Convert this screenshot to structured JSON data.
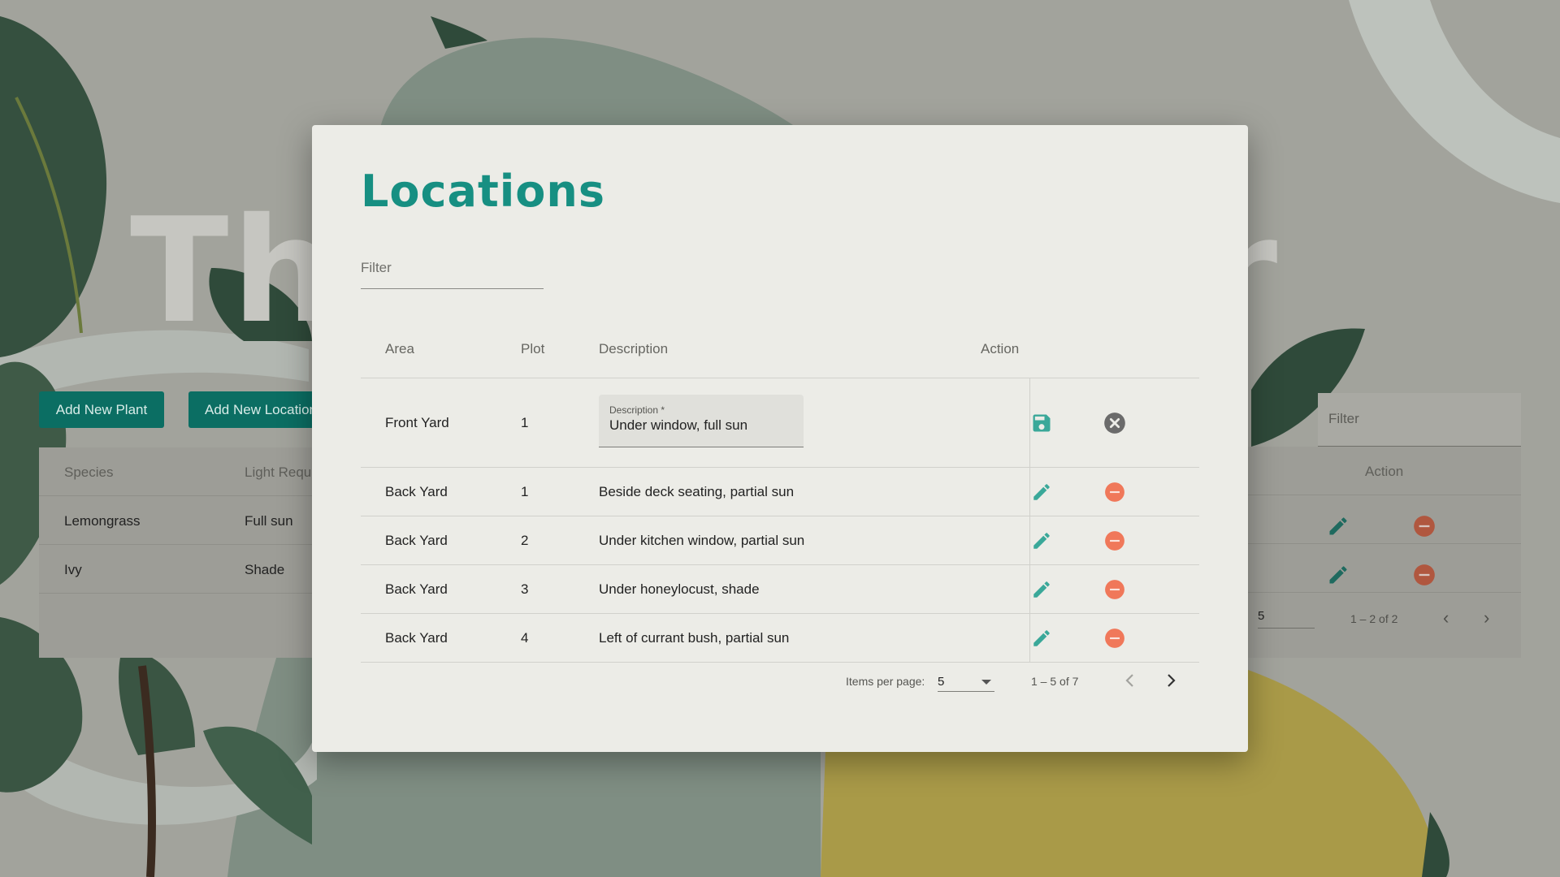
{
  "background": {
    "title": "The Gardener",
    "buttons": {
      "add_plant": "Add New Plant",
      "add_location": "Add New Location"
    },
    "plants_table": {
      "headers": [
        "Species",
        "Light Requirement"
      ],
      "rows": [
        [
          "Lemongrass",
          "Full sun"
        ],
        [
          "Ivy",
          "Shade"
        ]
      ],
      "filter_placeholder": "Filter",
      "action_header": "Action",
      "items_per_page": "5",
      "range": "1 – 2 of 2"
    }
  },
  "modal": {
    "title": "Locations",
    "filter_placeholder": "Filter",
    "headers": {
      "area": "Area",
      "plot": "Plot",
      "description": "Description",
      "action": "Action"
    },
    "editing_row": {
      "area": "Front Yard",
      "plot": "1",
      "description_label": "Description *",
      "description_value": "Under window, full sun"
    },
    "rows": [
      {
        "area": "Back Yard",
        "plot": "1",
        "description": "Beside deck seating, partial sun"
      },
      {
        "area": "Back Yard",
        "plot": "2",
        "description": "Under kitchen window, partial sun"
      },
      {
        "area": "Back Yard",
        "plot": "3",
        "description": "Under honeylocust, shade"
      },
      {
        "area": "Back Yard",
        "plot": "4",
        "description": "Left of currant bush, partial sun"
      }
    ],
    "paginator": {
      "items_per_page_label": "Items per page:",
      "items_per_page": "5",
      "range": "1 – 5 of 7"
    }
  },
  "icons": {
    "save": "save-icon",
    "cancel": "cancel-circle-icon",
    "edit": "pencil-icon",
    "delete": "minus-circle-icon",
    "prev": "chevron-left-icon",
    "next": "chevron-right-icon"
  },
  "colors": {
    "accent": "#178f82",
    "edit": "#3aa899",
    "delete": "#f0785a",
    "cancel": "#6b6b6b",
    "button": "#0b6e63",
    "olive": "#a99a48"
  }
}
